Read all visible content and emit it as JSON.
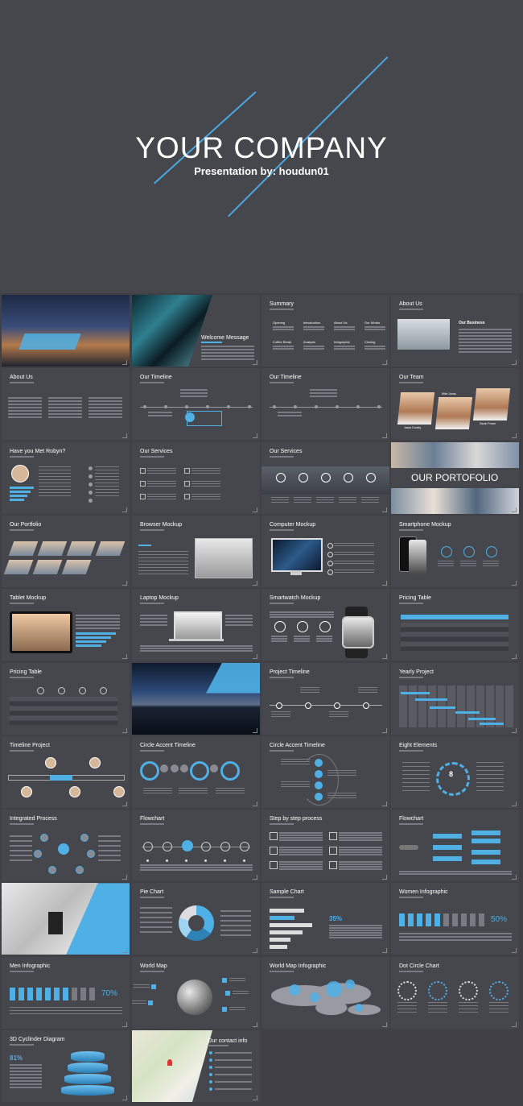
{
  "hero": {
    "title": "YOUR COMPANY",
    "subtitle": "Presentation by: houdun01"
  },
  "slides": [
    {
      "id": "s1",
      "title": "",
      "kind": "photo-city"
    },
    {
      "id": "s2",
      "title": "Welcome Message",
      "kind": "photo-bldg"
    },
    {
      "id": "s3",
      "title": "Summary",
      "kind": "summary"
    },
    {
      "id": "s4",
      "title": "About Us",
      "kind": "about-photo"
    },
    {
      "id": "s5",
      "title": "About Us",
      "kind": "text3"
    },
    {
      "id": "s6",
      "title": "Our Timeline",
      "kind": "timeline"
    },
    {
      "id": "s7",
      "title": "Our Timeline",
      "kind": "timeline2"
    },
    {
      "id": "s8",
      "title": "Our Team",
      "kind": "team"
    },
    {
      "id": "s9",
      "title": "Have you Met Robyn?",
      "kind": "profile"
    },
    {
      "id": "s10",
      "title": "Our Services",
      "kind": "services"
    },
    {
      "id": "s11",
      "title": "Our Services",
      "kind": "services2"
    },
    {
      "id": "s12",
      "title": "OUR PORTOFOLIO",
      "kind": "portfolio-big"
    },
    {
      "id": "s13",
      "title": "Our Portfolio",
      "kind": "portfolio"
    },
    {
      "id": "s14",
      "title": "Browser Mockup",
      "kind": "browser"
    },
    {
      "id": "s15",
      "title": "Computer Mockup",
      "kind": "computer"
    },
    {
      "id": "s16",
      "title": "Smartphone Mockup",
      "kind": "phone"
    },
    {
      "id": "s17",
      "title": "Tablet Mockup",
      "kind": "tablet"
    },
    {
      "id": "s18",
      "title": "Laptop Mockup",
      "kind": "laptop"
    },
    {
      "id": "s19",
      "title": "Smartwatch Mockup",
      "kind": "watch"
    },
    {
      "id": "s20",
      "title": "Pricing Table",
      "kind": "pricing"
    },
    {
      "id": "s21",
      "title": "Pricing Table",
      "kind": "pricing2"
    },
    {
      "id": "s22",
      "title": "",
      "kind": "photo-sea"
    },
    {
      "id": "s23",
      "title": "Project Timeline",
      "kind": "ptimeline"
    },
    {
      "id": "s24",
      "title": "Yearly Project",
      "kind": "gantt"
    },
    {
      "id": "s25",
      "title": "Timeline Project",
      "kind": "tproject"
    },
    {
      "id": "s26",
      "title": "Circle Accent Timeline",
      "kind": "circles"
    },
    {
      "id": "s27",
      "title": "Circle Accent Timeline",
      "kind": "circles2"
    },
    {
      "id": "s28",
      "title": "Eight Elements",
      "kind": "eight"
    },
    {
      "id": "s29",
      "title": "Integrated Process",
      "kind": "process"
    },
    {
      "id": "s30",
      "title": "Flowchart",
      "kind": "flow"
    },
    {
      "id": "s31",
      "title": "Step by step process",
      "kind": "steps"
    },
    {
      "id": "s32",
      "title": "Flowchart",
      "kind": "flow2"
    },
    {
      "id": "s33",
      "title": "",
      "kind": "photo-sketch"
    },
    {
      "id": "s34",
      "title": "Pie Chart",
      "kind": "pie"
    },
    {
      "id": "s35",
      "title": "Sample Chart",
      "kind": "hbars"
    },
    {
      "id": "s36",
      "title": "Women Infographic",
      "kind": "women"
    },
    {
      "id": "s37",
      "title": "Men Infographic",
      "kind": "men"
    },
    {
      "id": "s38",
      "title": "World Map",
      "kind": "globe"
    },
    {
      "id": "s39",
      "title": "World Map Infographic",
      "kind": "worldmap"
    },
    {
      "id": "s40",
      "title": "Dot Circle Chart",
      "kind": "dots"
    },
    {
      "id": "s41",
      "title": "3D Cyclinder Diagram",
      "kind": "cylinder"
    },
    {
      "id": "s42",
      "title": "Our contact info",
      "kind": "map"
    }
  ],
  "labels": {
    "portfolio_big": "OUR PORTOFOLIO",
    "women_pct": "50%",
    "men_pct": "70%",
    "sample_chart_pct": "35%",
    "eight_center": "8",
    "cylinder_pct": "81%",
    "summary_items": [
      "Opening",
      "Introduction",
      "About Us",
      "Our Works",
      "Coffee Break",
      "Analysis",
      "Infographic",
      "Closing"
    ],
    "about_heading": "Our Business",
    "team_names": [
      "Jason Dunley",
      "Mike Jonas",
      "Sarah Power"
    ]
  },
  "colors": {
    "accent": "#4fb0e6",
    "background": "#404046",
    "tile": "#46464d"
  }
}
